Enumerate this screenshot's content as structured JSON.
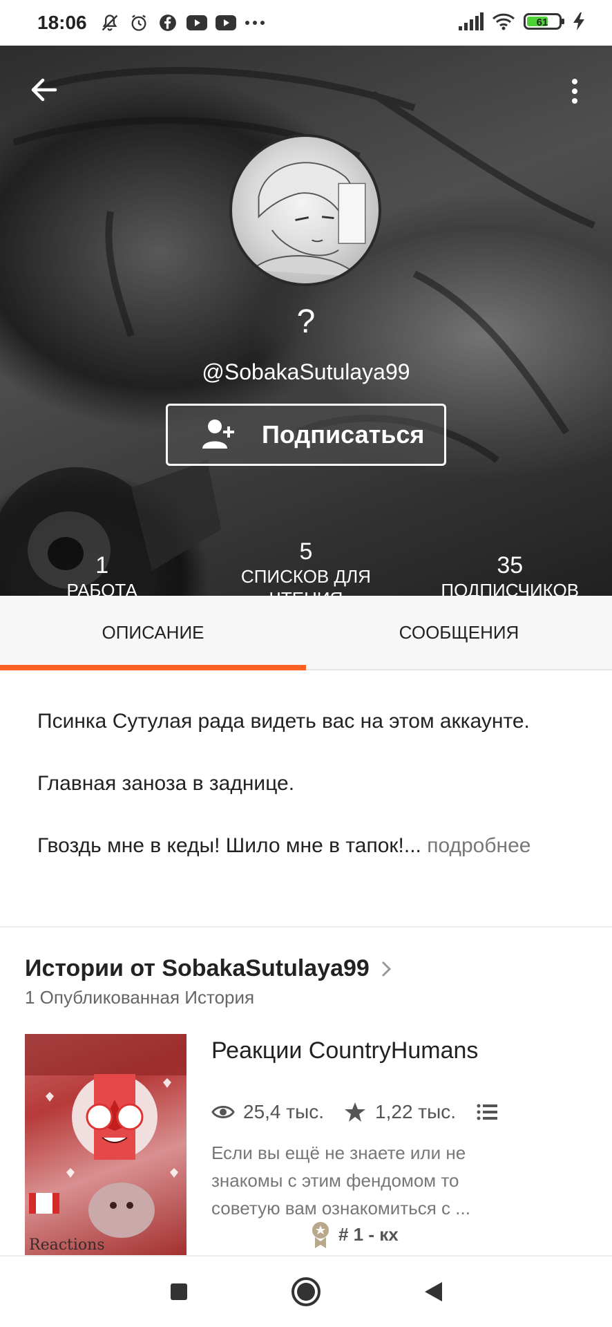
{
  "status_bar": {
    "time": "18:06",
    "battery": "61",
    "icons_left": [
      "bell-off-icon",
      "alarm-icon",
      "facebook-icon",
      "youtube-icon",
      "youtube-icon",
      "more-dots-icon"
    ],
    "icons_right": [
      "signal-icon",
      "wifi-icon",
      "battery-icon",
      "charging-icon"
    ]
  },
  "profile": {
    "display_name": "?",
    "username": "@SobakaSutulaya99",
    "follow_label": "Подписаться",
    "stats": [
      {
        "value": "1",
        "label": "РАБОТА"
      },
      {
        "value": "5",
        "label": "СПИСКОВ ДЛЯ ЧТЕНИЯ"
      },
      {
        "value": "35",
        "label": "ПОДПИСЧИКОВ"
      }
    ]
  },
  "tabs": [
    {
      "label": "ОПИСАНИЕ",
      "active": true
    },
    {
      "label": "СООБЩЕНИЯ",
      "active": false
    }
  ],
  "description": {
    "line1": "Псинка Сутулая рада видеть вас на этом аккаунте.",
    "line2": "Главная заноза в заднице.",
    "line3": "Гвоздь мне в кеды! Шило мне в тапок!...",
    "more": " подробнее"
  },
  "stories": {
    "title": "Истории от SobakaSutulaya99",
    "subtitle": "1 Опубликованная История",
    "items": [
      {
        "title": "Реакции CountryHumans",
        "reads": "25,4 тыс.",
        "votes": "1,22 тыс.",
        "description": "Если вы ещё не знаете или не знакомы с этим фендомом то советую вам ознакомиться с ...",
        "rank": "# 1 - кх",
        "cover_caption": "Reactions"
      }
    ]
  },
  "colors": {
    "accent": "#ff6122",
    "text": "#222222",
    "muted": "#777777"
  }
}
